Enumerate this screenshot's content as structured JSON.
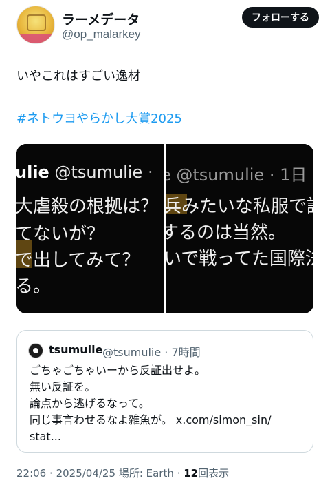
{
  "author": {
    "display_name": "ラーメデータ",
    "handle": "@op_malarkey",
    "follow_label": "フォローする"
  },
  "tweet": {
    "text": "いやこれはすごい逸材",
    "hashtag": "#ネトウヨやらかし大賞2025"
  },
  "media": {
    "left_panel": {
      "handle_name": "ulie",
      "handle_rest": "@tsumulie",
      "handle_dot": "·",
      "lines": [
        "大虐殺の根拠は？",
        "てないが？",
        "で出してみて？",
        "る。"
      ]
    },
    "right_panel": {
      "handle_rest": "e @tsumulie",
      "handle_time": "· 1日",
      "lines": [
        "兵みたいな私服で誤",
        "するのは当然。",
        "いで戦ってた国際法"
      ]
    }
  },
  "quote": {
    "name": "tsumulie",
    "meta": "@tsumulie · 7時間",
    "lines": [
      "ごちゃごちゃいーから反証出せよ。",
      "無い反証を。",
      "論点から逃げるなって。",
      "同じ事言わせるなよ雑魚が。 x.com/simon_sin/",
      "stat..."
    ]
  },
  "footer": {
    "time": "22:06",
    "date": "2025/04/25",
    "location": "場所: Earth",
    "views": "12",
    "views_label": "回表示"
  }
}
